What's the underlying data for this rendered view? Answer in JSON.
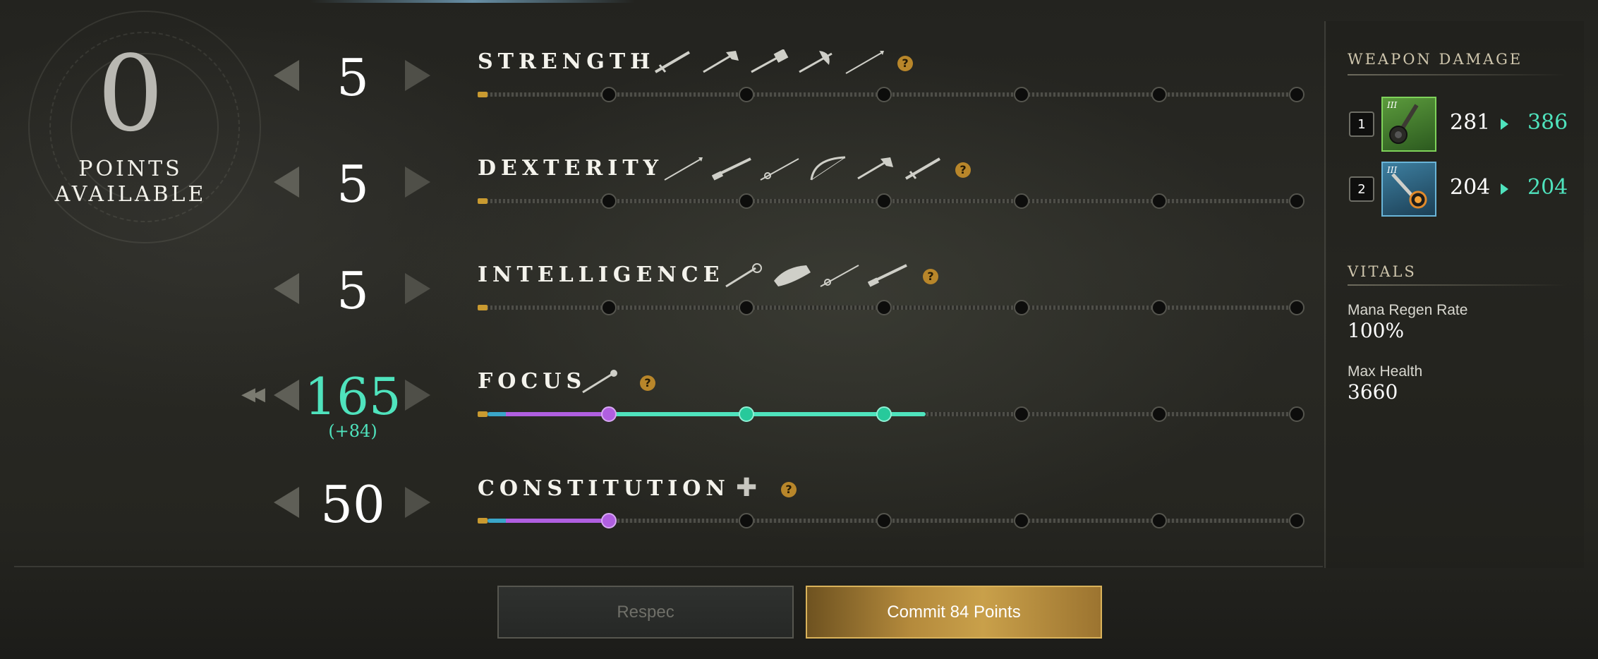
{
  "points": {
    "value": "0",
    "label": "POINTS\nAVAILABLE"
  },
  "attributes": [
    {
      "name": "STRENGTH",
      "value": "5",
      "bonus": "",
      "weapons": [
        "sword-icon",
        "hatchet-icon",
        "war-hammer-icon",
        "great-axe-icon",
        "spear-icon"
      ]
    },
    {
      "name": "DEXTERITY",
      "value": "5",
      "bonus": "",
      "weapons": [
        "spear-icon",
        "musket-icon",
        "rapier-icon",
        "bow-icon",
        "hatchet-icon",
        "sword-icon"
      ]
    },
    {
      "name": "INTELLIGENCE",
      "value": "5",
      "bonus": "",
      "weapons": [
        "fire-staff-icon",
        "ice-gauntlet-icon",
        "rapier-icon",
        "musket-icon"
      ]
    },
    {
      "name": "FOCUS",
      "value": "165",
      "bonus": "(+84)",
      "weapons": [
        "life-staff-icon"
      ]
    },
    {
      "name": "CONSTITUTION",
      "value": "50",
      "bonus": "",
      "weapons": []
    }
  ],
  "help_glyph": "?",
  "plus_glyph": "✚",
  "double_arrow": "◀◀",
  "weapon_damage": {
    "heading": "WEAPON DAMAGE",
    "slots": [
      {
        "slot": "1",
        "current": "281",
        "new": "386",
        "icon": "life-staff-icon",
        "tier": "III"
      },
      {
        "slot": "2",
        "current": "204",
        "new": "204",
        "icon": "fire-staff-icon",
        "tier": "III"
      }
    ]
  },
  "vitals": {
    "heading": "VITALS",
    "items": [
      {
        "label": "Mana Regen Rate",
        "value": "100%"
      },
      {
        "label": "Max Health",
        "value": "3660"
      }
    ]
  },
  "buttons": {
    "respec": "Respec",
    "commit": "Commit  84  Points"
  },
  "colors": {
    "accent_teal": "#4fe3bd",
    "purple": "#b05fe0",
    "gold": "#c99a30"
  }
}
